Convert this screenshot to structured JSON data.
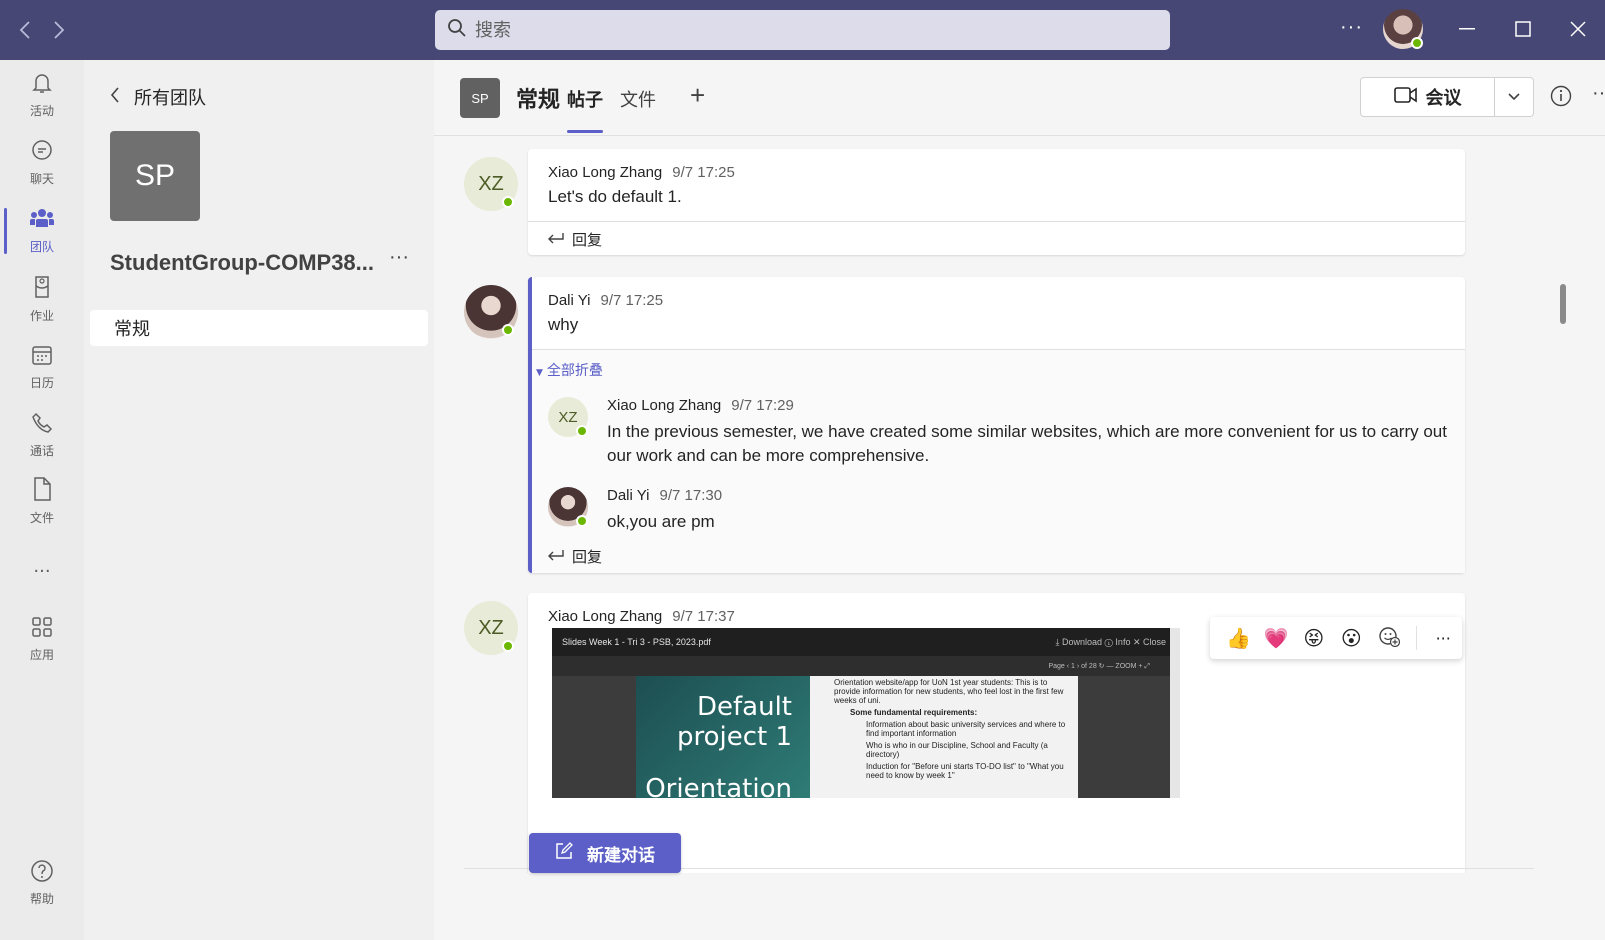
{
  "search": {
    "placeholder": "搜索"
  },
  "titlebar": {
    "more": "···"
  },
  "rail": [
    {
      "label": "活动",
      "icon": "bell-icon"
    },
    {
      "label": "聊天",
      "icon": "chat-icon"
    },
    {
      "label": "团队",
      "icon": "teams-icon"
    },
    {
      "label": "作业",
      "icon": "assignments-icon"
    },
    {
      "label": "日历",
      "icon": "calendar-icon"
    },
    {
      "label": "通话",
      "icon": "phone-icon"
    },
    {
      "label": "文件",
      "icon": "file-icon"
    },
    {
      "label": "···",
      "icon": "more-icon"
    },
    {
      "label": "应用",
      "icon": "apps-icon"
    },
    {
      "label": "帮助",
      "icon": "help-icon"
    }
  ],
  "panel": {
    "back_label": "所有团队",
    "team_initials": "SP",
    "team_name": "StudentGroup-COMP38...",
    "more": "···",
    "channel": "常规"
  },
  "header": {
    "channel_initials": "SP",
    "title": "常规",
    "tabs": [
      "帖子",
      "文件"
    ],
    "add": "+",
    "meet_label": "会议",
    "more": "···"
  },
  "messages": [
    {
      "author": "Xiao Long Zhang",
      "initials": "XZ",
      "time": "9/7 17:25",
      "text": "Let's do default 1.",
      "reply_label": "回复"
    },
    {
      "author": "Dali Yi",
      "time": "9/7 17:25",
      "text": "why",
      "collapse_label": "全部折叠",
      "replies": [
        {
          "author": "Xiao Long Zhang",
          "initials": "XZ",
          "time": "9/7 17:29",
          "text_line1": "In the previous semester, we have created some similar websites, which are more convenient for us to carry out",
          "text_line2": "our work and can be more comprehensive."
        },
        {
          "author": "Dali Yi",
          "time": "9/7 17:30",
          "text": "ok,you are pm"
        }
      ],
      "reply_label": "回复"
    },
    {
      "author": "Xiao Long Zhang",
      "initials": "XZ",
      "time": "9/7 17:37",
      "attachment": {
        "filename": "Slides Week 1 - Tri 3 - PSB, 2023.pdf",
        "toolbar": "⤓ Download    ⓘ Info    ✕ Close",
        "pager": "Page  ‹  1  ›  of 28    ↻    —  ZOOM  +    ⤢",
        "slide_title": "Default project 1",
        "slide_sub": "Orientation",
        "bullet_main": "Orientation website/app for UoN 1st year students: This is to provide information for new students, who feel lost in the first few weeks of uni.",
        "bullet_sub": "Some fundamental requirements:",
        "points": [
          "Information about basic university services and where to find important information",
          "Who is who in our Discipline, School and Faculty (a directory)",
          "Induction for \"Before uni starts TO-DO list\" to \"What you need to know by week 1\""
        ]
      }
    }
  ],
  "reactions": [
    "👍",
    "💗",
    "😝",
    "😮"
  ],
  "new_conversation": "新建对话"
}
